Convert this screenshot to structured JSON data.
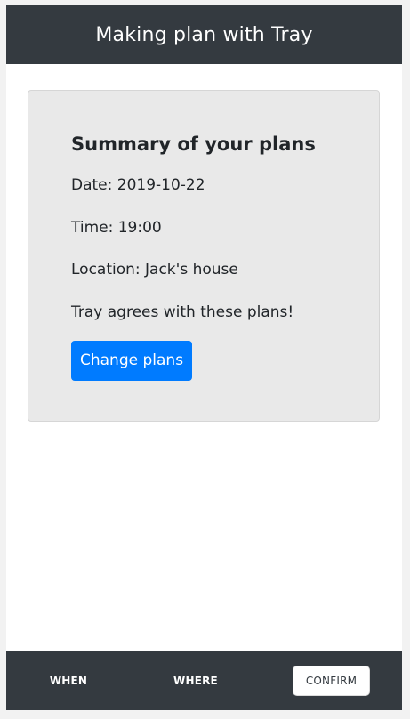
{
  "header": {
    "title": "Making plan with Tray"
  },
  "summary": {
    "title": "Summary of your plans",
    "date_line": "Date: 2019-10-22",
    "time_line": "Time: 19:00",
    "location_line": "Location: Jack's house",
    "agreement_line": "Tray agrees with these plans!",
    "change_button_label": "Change plans"
  },
  "footer": {
    "items": [
      {
        "label": "WHEN",
        "active": false
      },
      {
        "label": "WHERE",
        "active": false
      },
      {
        "label": "CONFIRM",
        "active": true
      }
    ]
  },
  "colors": {
    "header_bg": "#343a40",
    "card_bg": "#e9e9e9",
    "button_bg": "#007bff",
    "page_bg": "#ffffff"
  }
}
